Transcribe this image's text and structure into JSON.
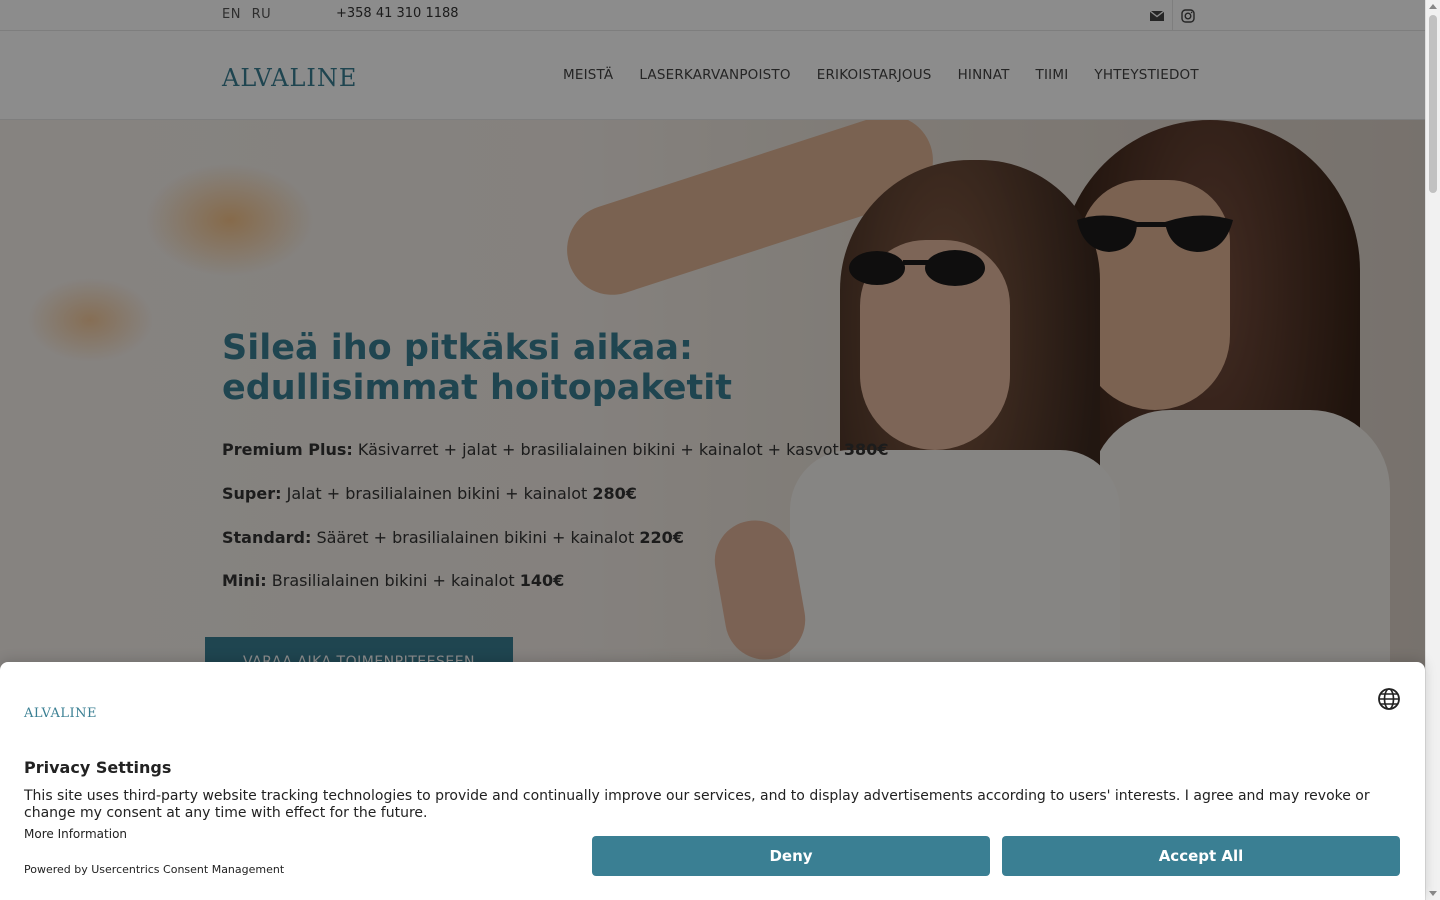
{
  "topbar": {
    "languages": [
      "EN",
      "RU"
    ],
    "phone": "+358 41 310 1188",
    "icons": [
      "mail-icon",
      "instagram-icon"
    ]
  },
  "header": {
    "logo": "ALVALINE",
    "nav": [
      "MEISTÄ",
      "LASERKARVANPOISTO",
      "ERIKOISTARJOUS",
      "HINNAT",
      "TIIMI",
      "YHTEYSTIEDOT"
    ]
  },
  "hero": {
    "title_line1": "Sileä iho pitkäksi aikaa:",
    "title_line2": "edullisimmat hoitopaketit",
    "packages": [
      {
        "name": "Premium Plus:",
        "desc": " Käsivarret + jalat + brasilialainen bikini + kainalot + kasvot ",
        "price": "380€"
      },
      {
        "name": "Super:",
        "desc": " Jalat + brasilialainen bikini + kainalot ",
        "price": "280€"
      },
      {
        "name": "Standard:",
        "desc": " Sääret + brasilialainen bikini + kainalot ",
        "price": "220€"
      },
      {
        "name": "Mini:",
        "desc": " Brasilialainen bikini + kainalot ",
        "price": "140€"
      }
    ],
    "cta": "VARAA AIKA TOIMENPITEESEEN"
  },
  "consent": {
    "logo": "ALVALINE",
    "title": "Privacy Settings",
    "text": "This site uses third-party website tracking technologies to provide and continually improve our services, and to display advertisements according to users' interests. I agree and may revoke or change my consent at any time with effect for the future.",
    "more": "More Information",
    "powered": "Powered by Usercentrics Consent Management",
    "deny": "Deny",
    "accept": "Accept All"
  },
  "colors": {
    "brand": "#3a7f93",
    "overlay": "rgba(0,0,0,0.45)"
  }
}
